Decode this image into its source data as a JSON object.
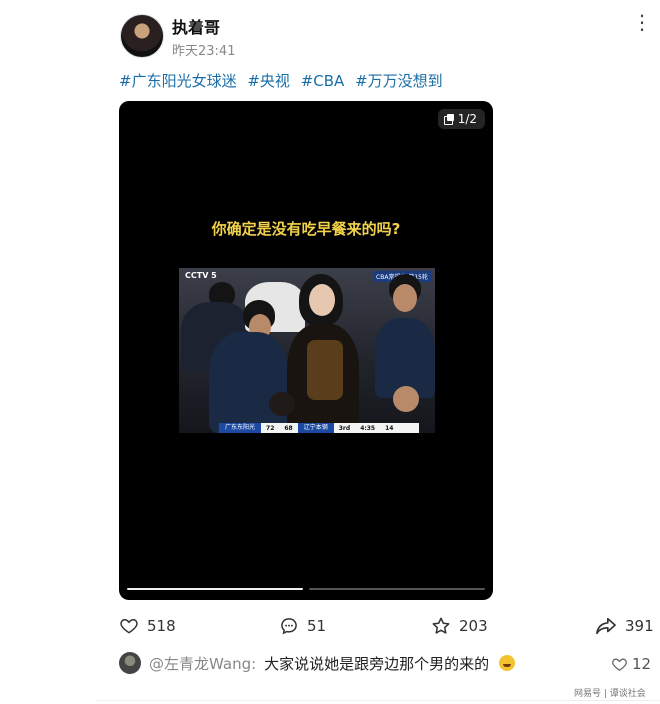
{
  "post": {
    "author": "执着哥",
    "time": "昨天23:41",
    "tags": [
      "#广东阳光女球迷",
      "#央视",
      "#CBA",
      "#万万没想到"
    ]
  },
  "media": {
    "counter": "1/2",
    "caption": "你确定是没有吃早餐来的吗?",
    "broadcast": {
      "channel_logo": "CCTV 5",
      "event_tag": "CBA常规赛 第15轮",
      "home_team": "广东东阳光",
      "home_score": "72",
      "away_score": "68",
      "away_team": "辽宁本钢",
      "quarter": "3rd",
      "clock": "4:35",
      "shot_clock": "14"
    },
    "progress": {
      "current_slide": 1,
      "total_slides": 2
    }
  },
  "actions": {
    "like_count": "518",
    "comment_count": "51",
    "favorite_count": "203",
    "share_count": "391"
  },
  "top_comment": {
    "user": "@左青龙Wang:",
    "text": "大家说说她是跟旁边那个男的来的",
    "likes": "12"
  },
  "watermark": "网易号 | 谭谈社会",
  "colors": {
    "link": "#1a6ea8",
    "caption": "#f2d24a",
    "media_bg": "#000000"
  }
}
